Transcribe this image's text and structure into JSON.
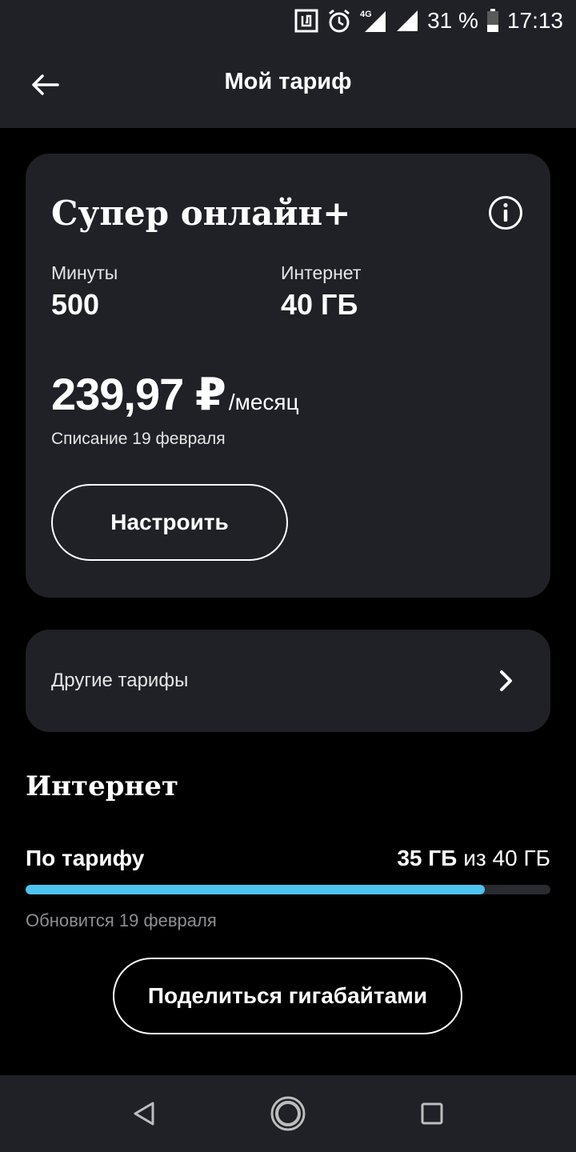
{
  "status_bar": {
    "battery": "31 %",
    "time": "17:13",
    "network": "4G",
    "icons": [
      "nfc-icon",
      "alarm-icon",
      "signal-4g-icon",
      "signal-icon",
      "battery-icon"
    ]
  },
  "app_bar": {
    "title": "Мой тариф",
    "back_icon": "arrow-left-icon"
  },
  "tariff": {
    "name": "Супер онлайн+",
    "info_icon": "info-icon",
    "minutes_label": "Минуты",
    "minutes_value": "500",
    "internet_label": "Интернет",
    "internet_value": "40 ГБ",
    "price": "239,97 ₽",
    "price_period": "/месяц",
    "charge_date": "Списание 19 февраля",
    "setup_button": "Настроить"
  },
  "other_tariffs": {
    "label": "Другие тарифы",
    "chevron_icon": "chevron-right-icon"
  },
  "internet_section": {
    "title": "Интернет",
    "usage_label": "По тарифу",
    "usage_remaining": "35 ГБ",
    "usage_of": "из 40 ГБ",
    "usage_fraction": 0.875,
    "renew_text": "Обновится 19 февраля",
    "share_button": "Поделиться гигабайтами"
  },
  "colors": {
    "background": "#000000",
    "card": "#202127",
    "accent": "#4ec3ef",
    "text": "#ffffff",
    "muted": "#8e8e93"
  },
  "nav_bar": {
    "icons": [
      "back-triangle-icon",
      "home-circle-icon",
      "recents-square-icon"
    ]
  }
}
